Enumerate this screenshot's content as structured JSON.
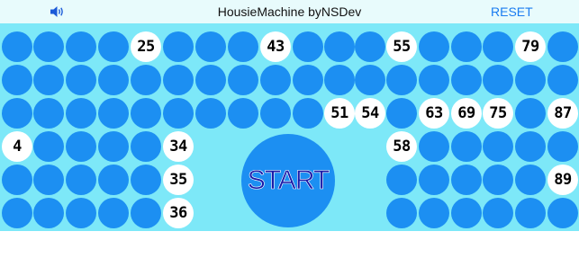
{
  "header": {
    "title": "HousieMachine byNSDev",
    "reset_label": "RESET",
    "sound_icon": "speaker-volume-icon"
  },
  "start_label": "START",
  "colors": {
    "board_bg": "#7de8f8",
    "ball_undrawn": "#1c8ff2",
    "ball_drawn": "#ffffff",
    "reset_text": "#1a7cf0",
    "start_text": "#1a1aa8"
  },
  "board": {
    "rows": [
      [
        "",
        "",
        "",
        "",
        "25",
        "",
        "",
        "",
        "43",
        "",
        "",
        "",
        "55",
        "",
        "",
        "",
        "79",
        ""
      ],
      [
        "",
        "",
        "",
        "",
        "",
        "",
        "",
        "",
        "",
        "",
        "",
        "",
        "",
        "",
        "",
        "",
        "",
        ""
      ],
      [
        "",
        "",
        "",
        "",
        "",
        "",
        "",
        "",
        "",
        "",
        "51",
        "54",
        "",
        "63",
        "69",
        "75",
        "",
        "87"
      ],
      [
        "4",
        "",
        "",
        "",
        "",
        "34",
        null,
        null,
        null,
        null,
        null,
        null,
        "58",
        "",
        "",
        "",
        "",
        ""
      ],
      [
        "",
        "",
        "",
        "",
        "",
        "35",
        null,
        null,
        null,
        null,
        null,
        null,
        "",
        "",
        "",
        "",
        "",
        "89"
      ],
      [
        "",
        "",
        "",
        "",
        "",
        "36",
        null,
        null,
        null,
        null,
        null,
        null,
        "",
        "",
        "",
        "",
        "",
        ""
      ]
    ]
  }
}
